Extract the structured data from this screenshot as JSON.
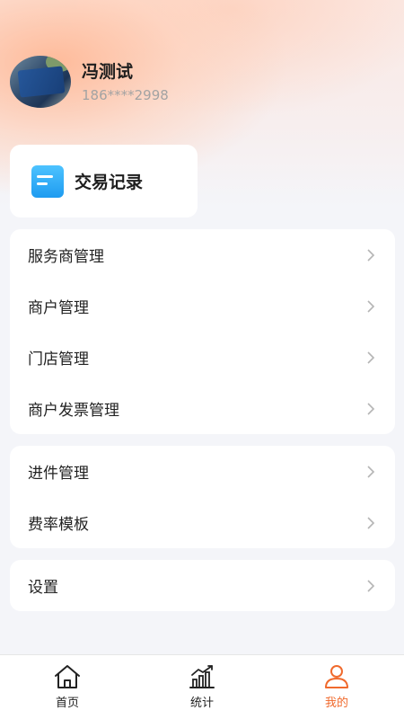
{
  "profile": {
    "name": "冯测试",
    "phone": "186****2998"
  },
  "quick": {
    "label": "交易记录",
    "icon": "document-icon"
  },
  "menu_group_1": [
    {
      "label": "服务商管理"
    },
    {
      "label": "商户管理"
    },
    {
      "label": "门店管理"
    },
    {
      "label": "商户发票管理"
    }
  ],
  "menu_group_2": [
    {
      "label": "进件管理"
    },
    {
      "label": "费率模板"
    }
  ],
  "menu_group_3": [
    {
      "label": "设置"
    }
  ],
  "tabbar": {
    "active": "mine",
    "items": [
      {
        "label": "首页",
        "icon": "home-icon"
      },
      {
        "label": "统计",
        "icon": "chart-icon"
      },
      {
        "label": "我的",
        "icon": "user-icon"
      }
    ]
  },
  "colors": {
    "accent": "#f06a2d",
    "page_bg": "#f4f5f9",
    "card_bg": "#ffffff"
  }
}
